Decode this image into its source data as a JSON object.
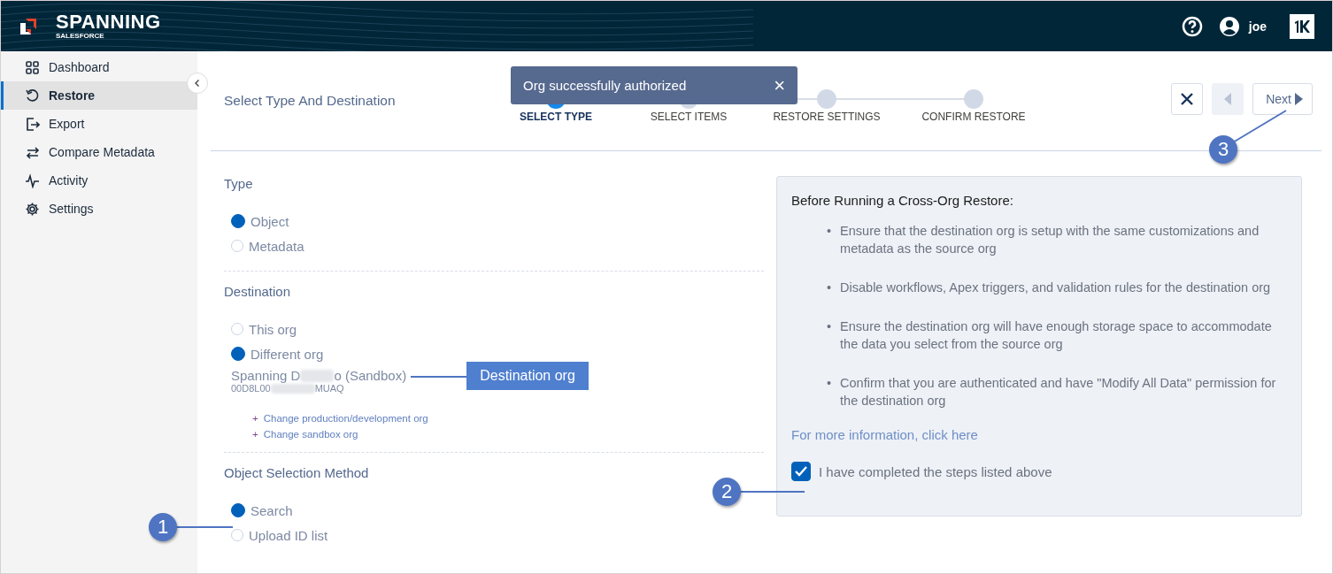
{
  "header": {
    "brand": "SPANNING",
    "sub_brand": "SALESFORCE",
    "user": "joe"
  },
  "sidebar": {
    "items": [
      {
        "label": "Dashboard",
        "selected": false
      },
      {
        "label": "Restore",
        "selected": true
      },
      {
        "label": "Export",
        "selected": false
      },
      {
        "label": "Compare Metadata",
        "selected": false
      },
      {
        "label": "Activity",
        "selected": false
      },
      {
        "label": "Settings",
        "selected": false
      }
    ]
  },
  "page_title": "Select Type And Destination",
  "toast": {
    "message": "Org successfully authorized",
    "close": "×"
  },
  "steps": [
    {
      "label": "SELECT TYPE",
      "selected": true
    },
    {
      "label": "SELECT ITEMS",
      "selected": false
    },
    {
      "label": "RESTORE SETTINGS",
      "selected": false
    },
    {
      "label": "CONFIRM RESTORE",
      "selected": false
    }
  ],
  "nav": {
    "previous_disabled": true,
    "next": "Next"
  },
  "type_section": {
    "heading": "Type",
    "options": [
      {
        "label": "Object",
        "selected": true
      },
      {
        "label": "Metadata",
        "selected": false
      }
    ]
  },
  "destination_section": {
    "heading": "Destination",
    "options": [
      {
        "label": "This org",
        "selected": false
      },
      {
        "label": "Different org",
        "selected": true
      }
    ],
    "org_name_start": "Spanning D",
    "org_name_end": "o (Sandbox)",
    "org_id_start": "00D8L00",
    "org_id_end": "MUAQ",
    "links": [
      {
        "icon": "+",
        "label": "Change production/development org"
      },
      {
        "icon": "+",
        "label": "Change sandbox org"
      }
    ]
  },
  "selection_section": {
    "heading": "Object Selection Method",
    "options": [
      {
        "label": "Search",
        "selected": true
      },
      {
        "label": "Upload ID list",
        "selected": false
      }
    ]
  },
  "info_panel": {
    "title": "Before Running a Cross-Org Restore:",
    "bullets": [
      {
        "marker": "•",
        "text": "Ensure that the destination org is setup with the same customizations and metadata as the source org"
      },
      {
        "marker": "•",
        "text": "Disable workflows, Apex triggers, and validation rules for the destination org"
      },
      {
        "marker": "•",
        "text": "Ensure the destination org will have enough storage space to accommodate the data you select from the source org"
      },
      {
        "marker": "•",
        "text": "Confirm that you are authenticated and have \"Modify All Data\" permission for the destination org"
      }
    ],
    "link": "For more information, click here",
    "confirm": {
      "label": "I have completed the steps listed above",
      "checked": true
    }
  },
  "annotations": {
    "callouts": [
      "1",
      "2",
      "3"
    ],
    "label": "Destination org"
  }
}
